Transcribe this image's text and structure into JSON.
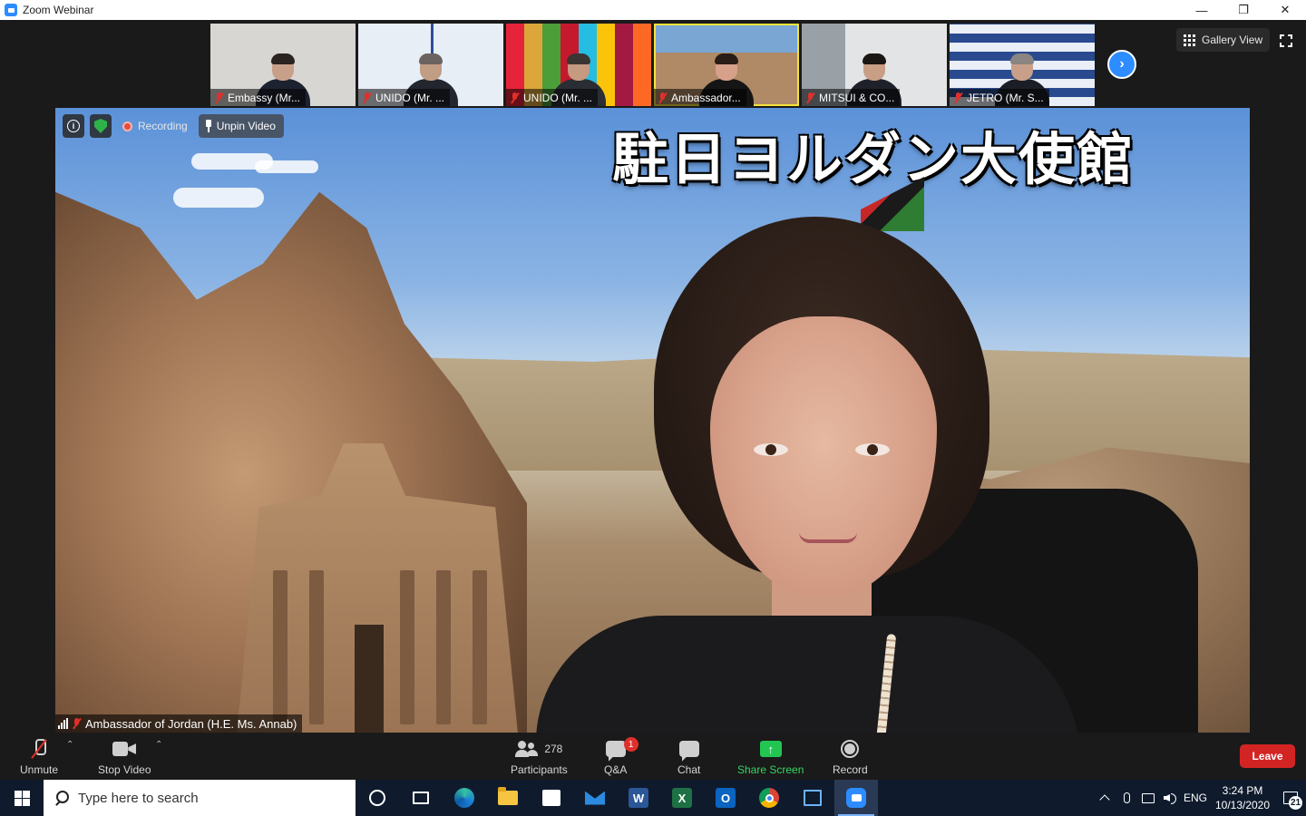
{
  "window": {
    "title": "Zoom Webinar",
    "minimize": "—",
    "restore": "❐",
    "close": "✕"
  },
  "thumbnails": [
    {
      "label": "Embassy (Mr...",
      "bg": "#d8d6d2"
    },
    {
      "label": "UNIDO (Mr. ...",
      "bg": "#d9e3f0"
    },
    {
      "label": "UNIDO (Mr. ...",
      "bg": "#b9c7c9"
    },
    {
      "label": "Ambassador...",
      "bg": "#a8856a"
    },
    {
      "label": "MITSUI & CO...",
      "bg": "#d6d8da"
    },
    {
      "label": "JETRO (Mr. S...",
      "bg": "#2a4a8f"
    }
  ],
  "gallery": {
    "label": "Gallery View"
  },
  "main_video": {
    "banner": "駐日ヨルダン大使館",
    "recording_label": "Recording",
    "unpin_label": "Unpin Video",
    "speaker_name": "Ambassador of Jordan (H.E. Ms. Annab)"
  },
  "toolbar": {
    "unmute": "Unmute",
    "stop_video": "Stop Video",
    "participants": "Participants",
    "participants_count": "278",
    "qa": "Q&A",
    "qa_badge": "1",
    "chat": "Chat",
    "share_screen": "Share Screen",
    "record": "Record",
    "leave": "Leave"
  },
  "taskbar": {
    "search_placeholder": "Type here to search",
    "word_letter": "W",
    "excel_letter": "X",
    "outlook_letter": "O",
    "language": "ENG",
    "time": "3:24 PM",
    "date": "10/13/2020",
    "notifications": "21"
  },
  "colors": {
    "zoom_blue": "#2d8cff",
    "leave_red": "#d32424",
    "share_green": "#23c552",
    "taskbar": "#0f1b2d"
  }
}
